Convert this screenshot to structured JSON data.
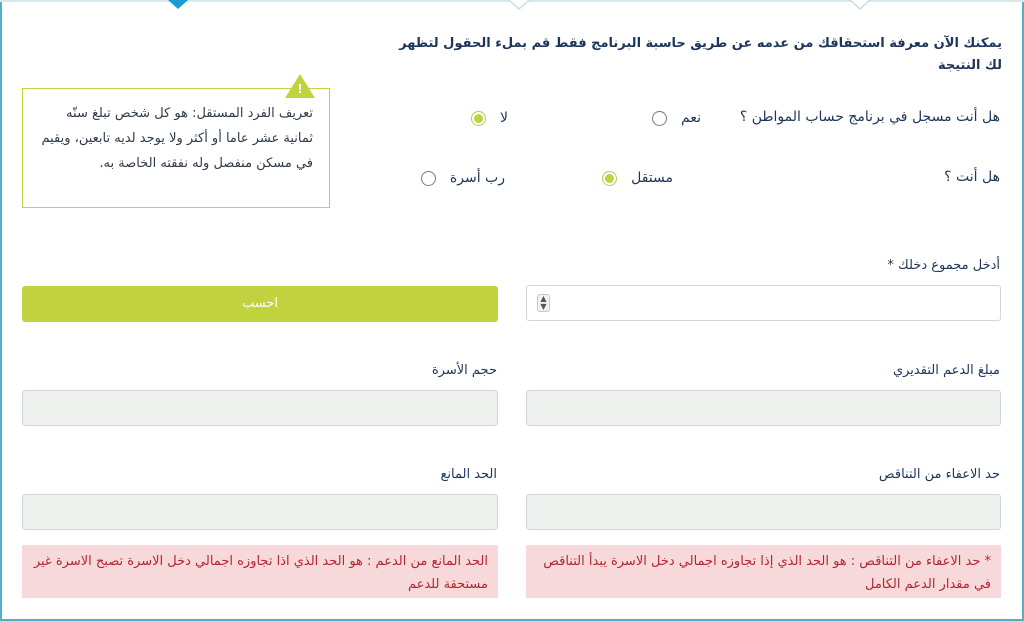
{
  "intro_text": "يمكنك الآن معرفة استحقاقك من عدمه عن طريق حاسبة البرنامج فقط قم بملء الحقول لتظهر لك النتيجة",
  "question1": {
    "label": "هل أنت مسجل في برنامج حساب المواطن ؟",
    "options": [
      {
        "label": "نعم",
        "checked": false
      },
      {
        "label": "لا",
        "checked": true
      }
    ]
  },
  "question2": {
    "label": "هل أنت ؟",
    "options": [
      {
        "label": "مستقل",
        "checked": true
      },
      {
        "label": "رب أسرة",
        "checked": false
      }
    ]
  },
  "tooltip": {
    "text": "تعريف الفرد المستقل: هو كل شخص تبلغ سنّه ثمانية عشر عاما أو أكثر ولا يوجد لديه تابعين، ويقيم في مسكن منفصل وله نفقته الخاصة به.",
    "icon": "warning-icon",
    "icon_glyph": "!",
    "accent": "#c1d23f"
  },
  "income": {
    "label": "أدخل مجموع دخلك *",
    "value": "",
    "spinner_up": "▲",
    "spinner_down": "▼"
  },
  "calculate_button": "احسب",
  "results": {
    "estimated_support_label": "مبلغ الدعم التقديري",
    "family_size_label": "حجم الأسرة",
    "exemption_limit_label": "حد الاعفاء من التناقص",
    "prohibitive_limit_label": "الحد المانع"
  },
  "notes": {
    "exemption": "* حد الاعفاء من التناقص : هو الحد الذي إذا تجاوزه اجمالي دخل الاسرة يبدأ التناقص في مقدار الدعم الكامل",
    "prohibitive": "الحد المانع من الدعم : هو الحد الذي اذا تجاوزه اجمالي دخل الاسرة تصبح الاسرة غير مستحقة للدعم"
  },
  "colors": {
    "accent_green": "#c1d23f",
    "text_navy": "#1d3559",
    "note_bg": "#f7d9dc",
    "note_text": "#b3262f",
    "frame": "#4fb0c6",
    "active_tab": "#1b9bd1"
  }
}
